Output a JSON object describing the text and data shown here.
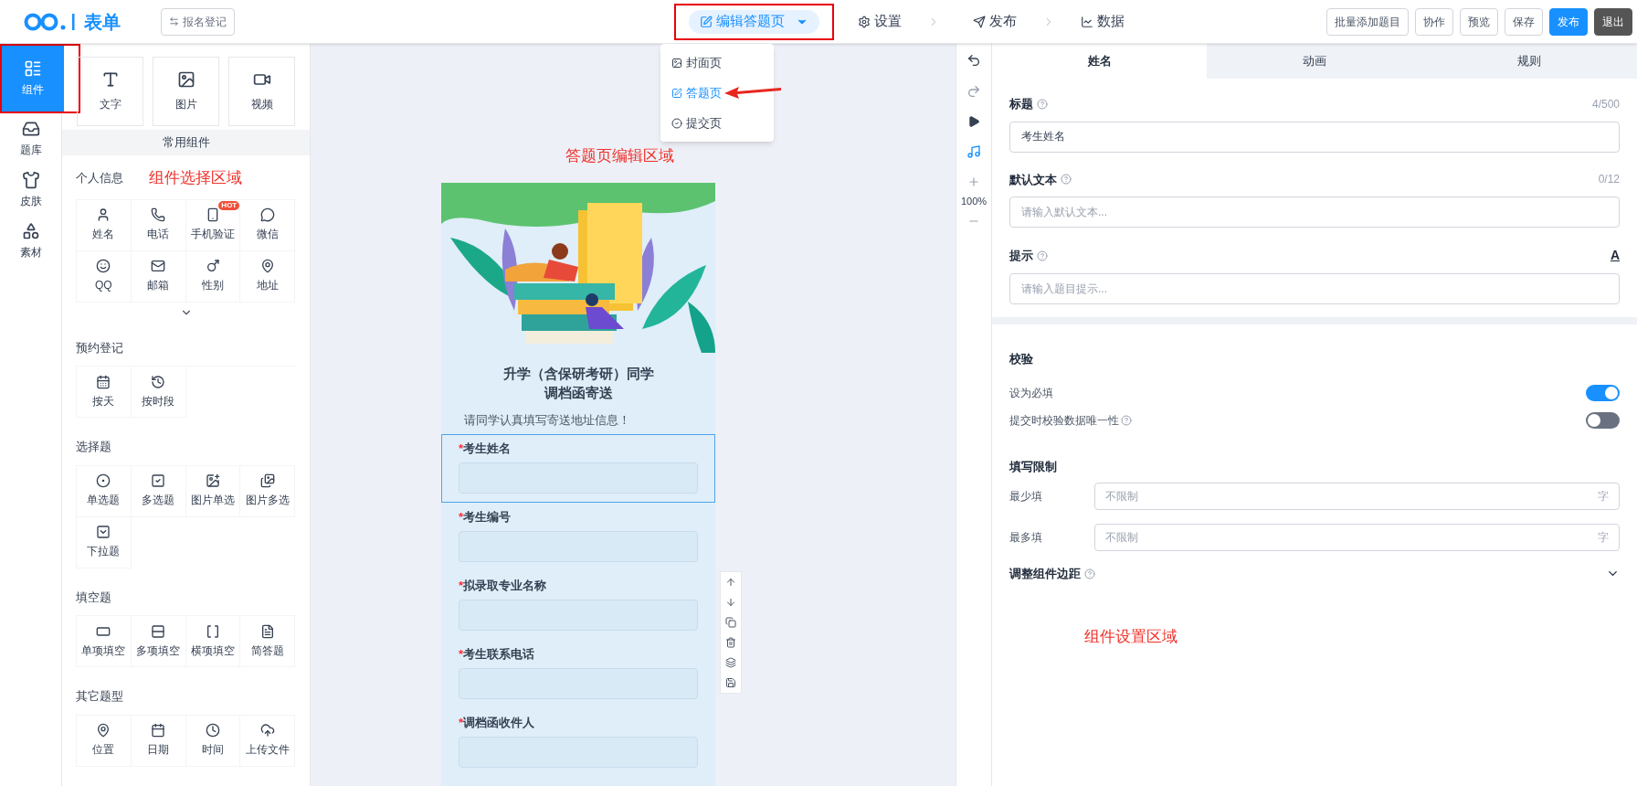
{
  "logo": {
    "text": "表单"
  },
  "signup_button": "报名登记",
  "steps": [
    {
      "label": "编辑答题页",
      "selected": true,
      "kind": "dropdown"
    },
    {
      "label": "设置",
      "selected": false,
      "kind": "step"
    },
    {
      "label": "发布",
      "selected": false,
      "kind": "step"
    },
    {
      "label": "数据",
      "selected": false,
      "kind": "step"
    }
  ],
  "page_menu": [
    {
      "label": "封面页",
      "selected": false
    },
    {
      "label": "答题页",
      "selected": true
    },
    {
      "label": "提交页",
      "selected": false
    }
  ],
  "actions": [
    {
      "label": "批量添加题目",
      "kind": "outline"
    },
    {
      "label": "协作",
      "kind": "outline"
    },
    {
      "label": "预览",
      "kind": "outline"
    },
    {
      "label": "保存",
      "kind": "outline"
    },
    {
      "label": "发布",
      "kind": "primary"
    },
    {
      "label": "退出",
      "kind": "dark"
    }
  ],
  "rail": [
    {
      "label": "组件",
      "selected": true
    },
    {
      "label": "题库",
      "selected": false
    },
    {
      "label": "皮肤",
      "selected": false
    },
    {
      "label": "素材",
      "selected": false
    }
  ],
  "basic_components": [
    "文字",
    "图片",
    "视频"
  ],
  "common_header": "常用组件",
  "groups": [
    {
      "title": "个人信息",
      "items": [
        {
          "label": "姓名"
        },
        {
          "label": "电话"
        },
        {
          "label": "手机验证",
          "badge": "HOT"
        },
        {
          "label": "微信"
        },
        {
          "label": "QQ"
        },
        {
          "label": "邮箱"
        },
        {
          "label": "性别"
        },
        {
          "label": "地址"
        }
      ],
      "more": true
    },
    {
      "title": "预约登记",
      "items": [
        {
          "label": "按天"
        },
        {
          "label": "按时段"
        }
      ]
    },
    {
      "title": "选择题",
      "items": [
        {
          "label": "单选题"
        },
        {
          "label": "多选题"
        },
        {
          "label": "图片单选"
        },
        {
          "label": "图片多选"
        },
        {
          "label": "下拉题"
        }
      ]
    },
    {
      "title": "填空题",
      "items": [
        {
          "label": "单项填空"
        },
        {
          "label": "多项填空"
        },
        {
          "label": "横项填空"
        },
        {
          "label": "简答题"
        }
      ]
    },
    {
      "title": "其它题型",
      "items": [
        {
          "label": "位置"
        },
        {
          "label": "日期"
        },
        {
          "label": "时间"
        },
        {
          "label": "上传文件"
        }
      ]
    }
  ],
  "form": {
    "required_symbol": "*",
    "title_lines": [
      "升学（含保研考研）同学",
      "调档函寄送"
    ],
    "intro": "请同学认真填写寄送地址信息！",
    "fields": [
      {
        "label": "考生姓名",
        "required": true,
        "selected": true
      },
      {
        "label": "考生编号",
        "required": true,
        "selected": false
      },
      {
        "label": "拟录取专业名称",
        "required": true,
        "selected": false
      },
      {
        "label": "考生联系电话",
        "required": true,
        "selected": false
      },
      {
        "label": "调档函收件人",
        "required": true,
        "selected": false
      }
    ]
  },
  "zoom": "100%",
  "settings": {
    "tabs": [
      {
        "label": "姓名",
        "selected": true
      },
      {
        "label": "动画",
        "selected": false
      },
      {
        "label": "规则",
        "selected": false
      }
    ],
    "inputs": [
      {
        "label": "标题",
        "count": "4/500",
        "value": "考生姓名"
      },
      {
        "label": "默认文本",
        "count": "0/12",
        "placeholder": "请输入默认文本..."
      },
      {
        "label": "提示",
        "font_button": "A",
        "placeholder": "请输入题目提示..."
      }
    ],
    "validation_title": "校验",
    "toggles": [
      {
        "label": "设为必填",
        "on": true,
        "help": false
      },
      {
        "label": "提交时校验数据唯一性",
        "on": false,
        "help": true
      }
    ],
    "limit_title": "填写限制",
    "limits": [
      {
        "label": "最少填",
        "placeholder": "不限制",
        "unit": "字"
      },
      {
        "label": "最多填",
        "placeholder": "不限制",
        "unit": "字"
      }
    ],
    "margin_label": "调整组件边距"
  },
  "annotations": [
    {
      "text": "组件选择区域"
    },
    {
      "text": "答题页编辑区域"
    },
    {
      "text": "组件设置区域"
    }
  ]
}
